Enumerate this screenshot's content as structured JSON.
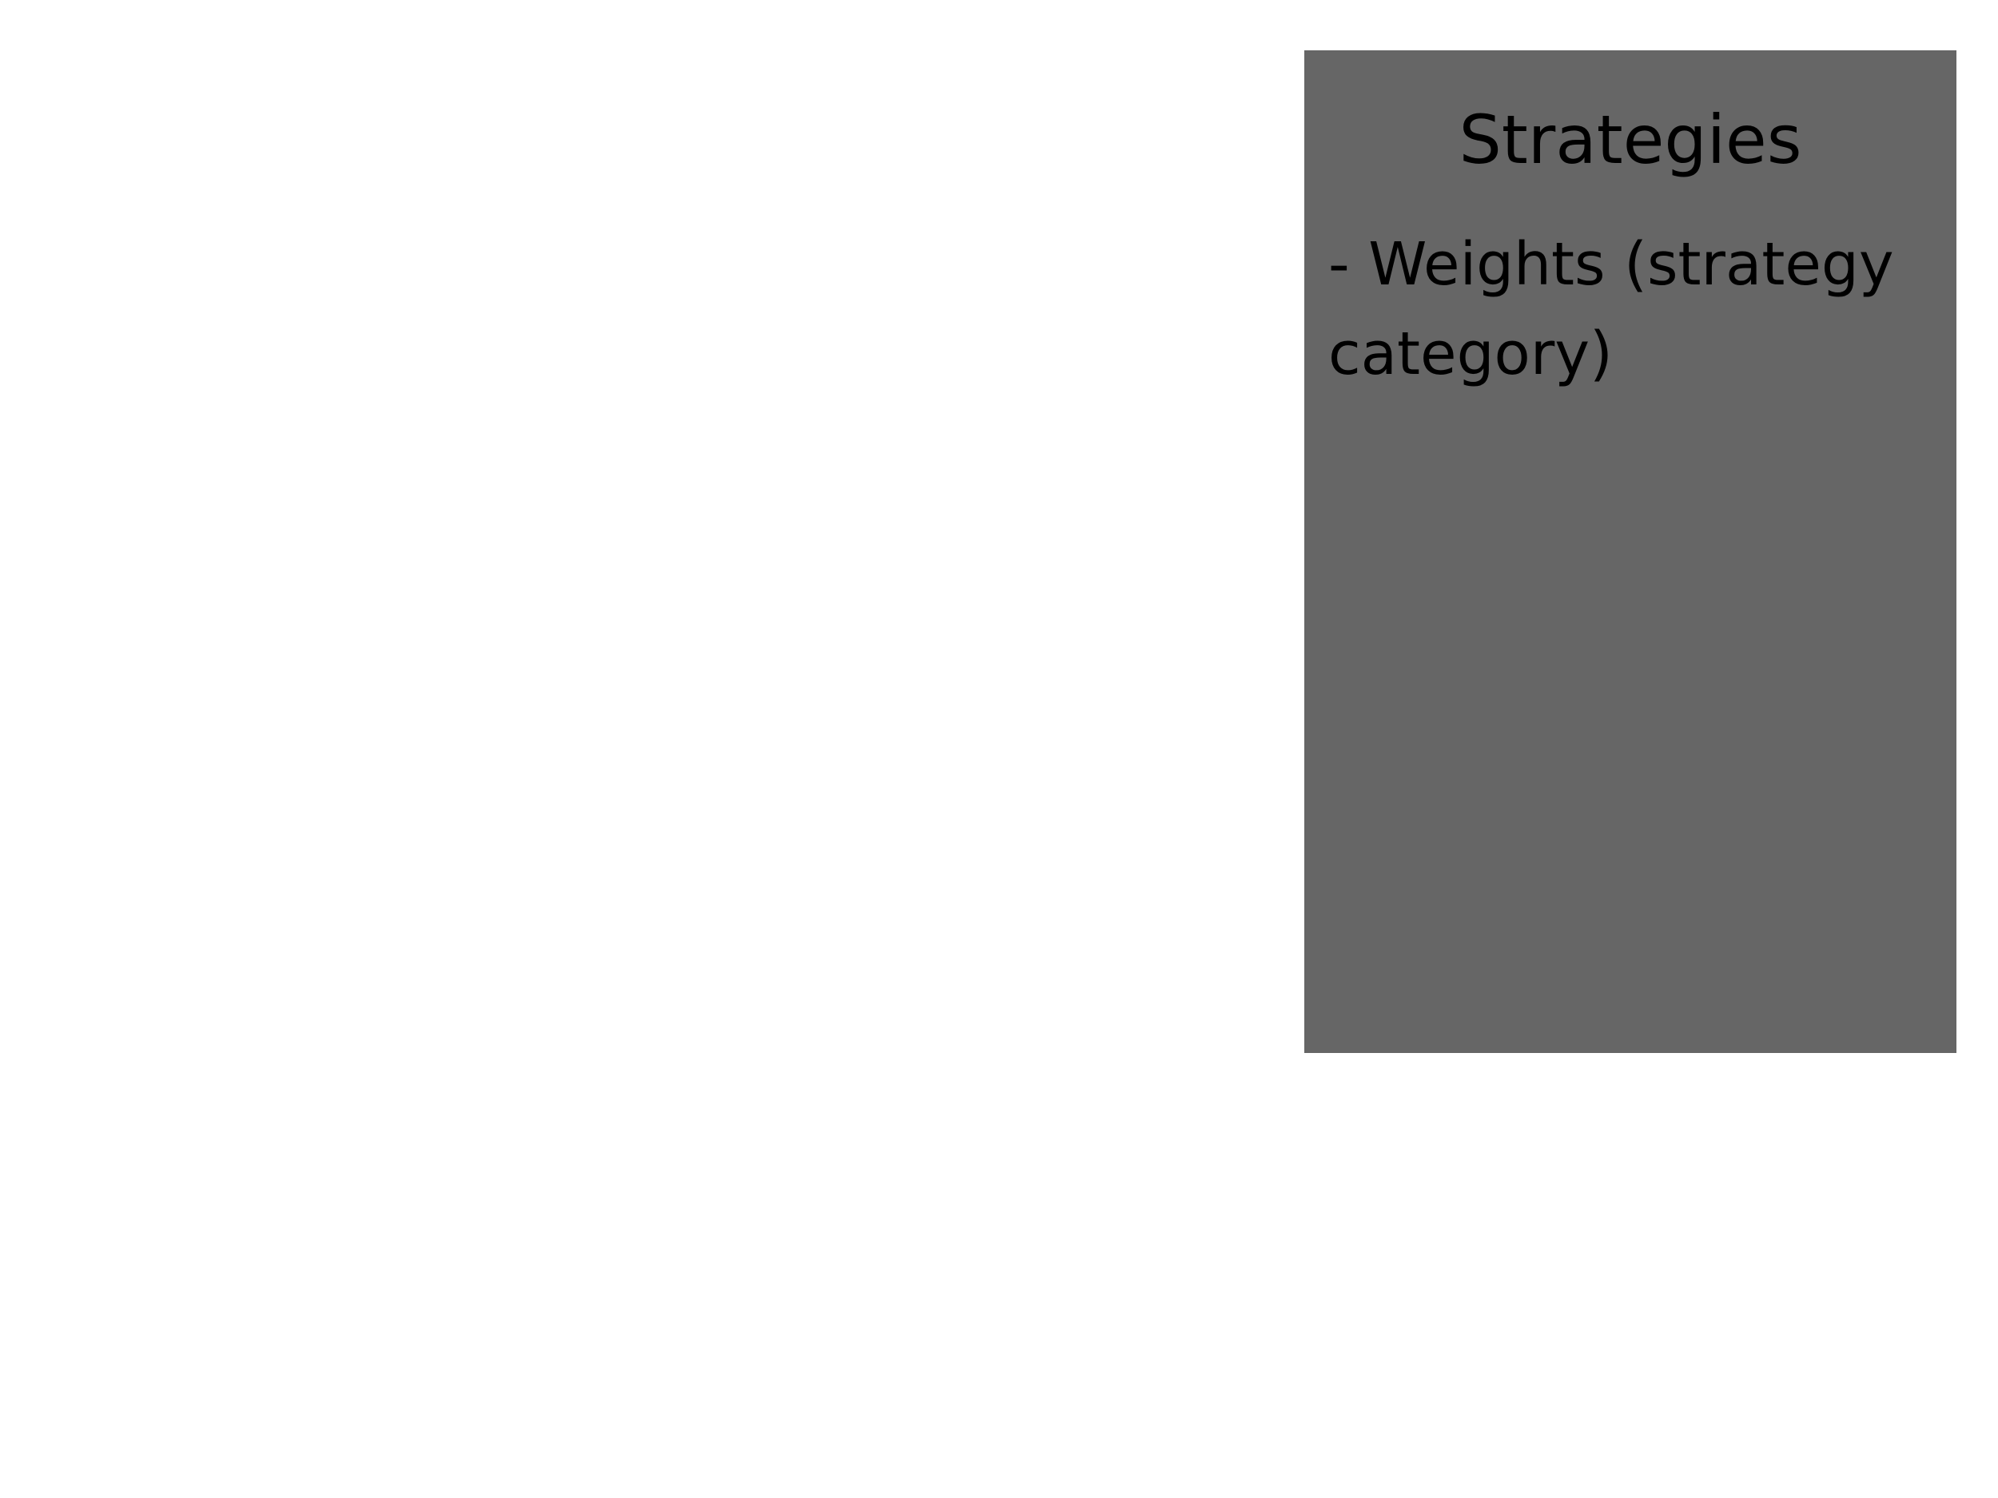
{
  "panel": {
    "title": "Strategies",
    "items": [
      "- Weights (strategy category)"
    ]
  },
  "colors": {
    "page_background": "#ffffff",
    "panel_background": "#666666",
    "text": "#000000"
  }
}
